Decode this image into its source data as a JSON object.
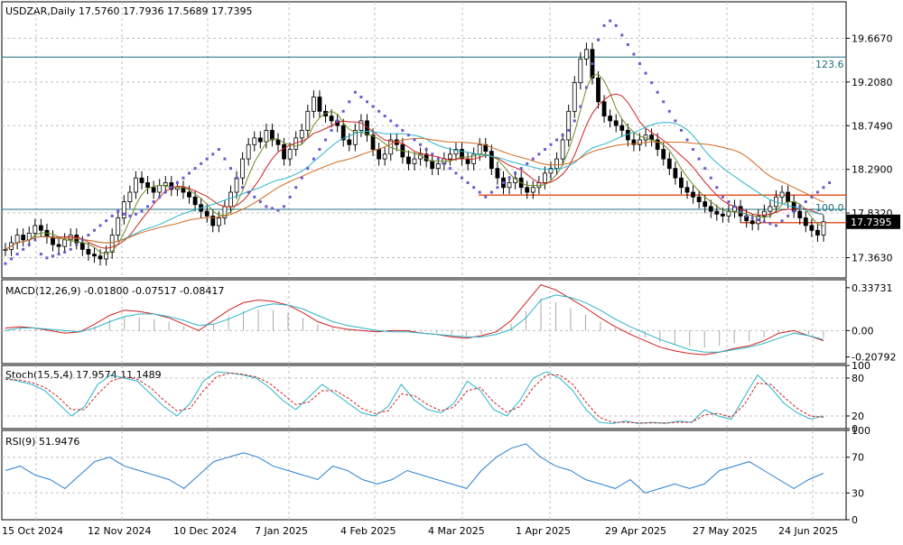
{
  "header": {
    "symbol_info": "USDZAR,Daily  17.5760 17.7936 17.5689 17.7395",
    "macd_info": "MACD(12,26,9) -0.01800 -0.07517 -0.08417",
    "stoch_info": "Stoch(15,5,4) 17.9574 11.1489",
    "rsi_info": "RSI(9) 51.9476"
  },
  "chart_data": [
    {
      "type": "candlestick",
      "title": "USDZAR,Daily",
      "ohlc_last": {
        "open": 17.576,
        "high": 17.7936,
        "low": 17.5689,
        "close": 17.7395
      },
      "ylim": [
        17.15,
        20.05
      ],
      "y_tick_labels": [
        "19.6670",
        "19.2080",
        "18.7490",
        "18.2900",
        "17.8320",
        "17.3630"
      ],
      "current_price_label": "17.7395",
      "x_tick_labels": [
        "15 Oct 2024",
        "12 Nov 2024",
        "10 Dec 2024",
        "7 Jan 2025",
        "4 Feb 2025",
        "4 Mar 2025",
        "1 Apr 2025",
        "29 Apr 2025",
        "27 May 2025",
        "24 Jun 2025"
      ],
      "fibonacci_labels": [
        "123.6",
        "100.0"
      ],
      "close_series": [
        17.45,
        17.52,
        17.6,
        17.55,
        17.62,
        17.7,
        17.65,
        17.58,
        17.5,
        17.48,
        17.55,
        17.6,
        17.52,
        17.45,
        17.4,
        17.38,
        17.35,
        17.42,
        17.6,
        17.78,
        17.95,
        18.05,
        18.2,
        18.15,
        18.1,
        18.05,
        18.12,
        18.15,
        18.08,
        18.1,
        18.05,
        18.0,
        17.92,
        17.85,
        17.8,
        17.7,
        17.78,
        17.9,
        18.05,
        18.2,
        18.4,
        18.55,
        18.62,
        18.58,
        18.7,
        18.6,
        18.55,
        18.4,
        18.5,
        18.62,
        18.7,
        18.9,
        19.05,
        18.9,
        18.85,
        18.8,
        18.75,
        18.6,
        18.55,
        18.7,
        18.8,
        18.65,
        18.5,
        18.4,
        18.45,
        18.6,
        18.55,
        18.42,
        18.35,
        18.4,
        18.45,
        18.38,
        18.3,
        18.35,
        18.4,
        18.45,
        18.5,
        18.4,
        18.35,
        18.45,
        18.55,
        18.48,
        18.3,
        18.2,
        18.1,
        18.15,
        18.2,
        18.1,
        18.05,
        18.1,
        18.15,
        18.25,
        18.3,
        18.4,
        18.6,
        18.9,
        19.2,
        19.45,
        19.55,
        19.25,
        19.0,
        18.85,
        18.8,
        18.75,
        18.7,
        18.6,
        18.55,
        18.6,
        18.65,
        18.6,
        18.5,
        18.4,
        18.3,
        18.2,
        18.1,
        18.05,
        18.0,
        17.95,
        17.9,
        17.85,
        17.82,
        17.8,
        17.85,
        17.9,
        17.8,
        17.75,
        17.72,
        17.8,
        17.85,
        17.9,
        18.0,
        18.05,
        17.95,
        17.85,
        17.78,
        17.7,
        17.65,
        17.6,
        17.74
      ],
      "parabolic_sar_series": [
        17.3,
        17.35,
        17.4,
        17.45,
        17.5,
        17.55,
        17.4,
        17.36,
        17.38,
        17.4,
        17.42,
        17.45,
        17.5,
        17.55,
        17.6,
        17.65,
        17.7,
        17.75,
        17.8,
        17.85,
        17.82,
        17.8,
        17.82,
        17.85,
        17.9,
        17.95,
        18.0,
        18.05,
        18.1,
        18.15,
        18.2,
        18.25,
        18.3,
        18.35,
        18.4,
        18.45,
        18.5,
        18.4,
        18.3,
        18.2,
        18.1,
        18.05,
        18.0,
        17.95,
        17.9,
        17.88,
        17.86,
        17.9,
        18.0,
        18.1,
        18.2,
        18.3,
        18.4,
        18.5,
        18.6,
        18.7,
        18.8,
        18.9,
        19.0,
        19.1,
        19.05,
        19.0,
        18.95,
        18.9,
        18.85,
        18.8,
        18.75,
        18.7,
        18.65,
        18.6,
        18.55,
        18.5,
        18.45,
        18.4,
        18.35,
        18.3,
        18.25,
        18.2,
        18.15,
        18.1,
        18.05,
        18.0,
        18.05,
        18.1,
        18.15,
        18.2,
        18.25,
        18.3,
        18.35,
        18.4,
        18.45,
        18.5,
        18.55,
        18.6,
        18.65,
        18.7,
        18.8,
        18.95,
        19.15,
        19.4,
        19.65,
        19.8,
        19.85,
        19.8,
        19.7,
        19.6,
        19.5,
        19.4,
        19.3,
        19.2,
        19.1,
        19.0,
        18.9,
        18.8,
        18.7,
        18.6,
        18.5,
        18.4,
        18.3,
        18.2,
        18.1,
        18.0,
        17.95,
        17.9,
        17.85,
        17.8,
        17.78,
        17.76,
        17.74,
        17.72,
        17.7,
        17.75,
        17.8,
        17.85,
        17.9,
        17.95,
        18.0,
        18.05,
        18.1,
        18.15
      ]
    },
    {
      "type": "line",
      "title": "MACD(12,26,9)",
      "values_text": "-0.01800 -0.07517 -0.08417",
      "ylim": [
        -0.26,
        0.4
      ],
      "y_tick_labels": [
        "0.33731",
        "0.00",
        "-0.20792"
      ],
      "series": [
        {
          "values": [
            0.02,
            0.03,
            0.02,
            0.0,
            -0.02,
            -0.01,
            0.05,
            0.12,
            0.16,
            0.15,
            0.13,
            0.1,
            0.05,
            0.0,
            0.08,
            0.16,
            0.22,
            0.24,
            0.23,
            0.2,
            0.14,
            0.07,
            0.03,
            0.01,
            0.0,
            -0.01,
            0.0,
            0.0,
            -0.02,
            -0.03,
            -0.05,
            -0.06,
            -0.04,
            -0.01,
            0.08,
            0.22,
            0.36,
            0.32,
            0.25,
            0.18,
            0.1,
            0.03,
            -0.03,
            -0.08,
            -0.13,
            -0.16,
            -0.18,
            -0.19,
            -0.17,
            -0.14,
            -0.12,
            -0.08,
            -0.02,
            0.0,
            -0.04,
            -0.08
          ]
        },
        {
          "values": [
            0.0,
            0.02,
            0.02,
            0.01,
            0.0,
            -0.01,
            0.02,
            0.07,
            0.11,
            0.13,
            0.13,
            0.11,
            0.08,
            0.04,
            0.05,
            0.09,
            0.14,
            0.19,
            0.21,
            0.2,
            0.17,
            0.12,
            0.07,
            0.04,
            0.02,
            0.0,
            -0.01,
            -0.01,
            -0.02,
            -0.03,
            -0.04,
            -0.05,
            -0.05,
            -0.03,
            0.01,
            0.1,
            0.24,
            0.28,
            0.26,
            0.22,
            0.16,
            0.09,
            0.03,
            -0.02,
            -0.07,
            -0.11,
            -0.15,
            -0.17,
            -0.17,
            -0.15,
            -0.13,
            -0.1,
            -0.06,
            -0.02,
            -0.04,
            -0.07
          ]
        }
      ]
    },
    {
      "type": "line",
      "title": "Stoch(15,5,4)",
      "values_text": "17.9574 11.1489",
      "ylim": [
        0,
        100
      ],
      "y_tick_labels": [
        "100",
        "80",
        "20",
        "0"
      ],
      "series": [
        {
          "values": [
            80,
            75,
            70,
            60,
            40,
            20,
            35,
            70,
            85,
            80,
            75,
            55,
            35,
            20,
            40,
            75,
            90,
            88,
            85,
            80,
            65,
            45,
            30,
            50,
            70,
            55,
            40,
            25,
            20,
            35,
            70,
            45,
            30,
            25,
            40,
            75,
            60,
            30,
            20,
            45,
            80,
            90,
            80,
            60,
            30,
            10,
            8,
            12,
            8,
            10,
            8,
            12,
            10,
            30,
            20,
            15,
            50,
            85,
            65,
            40,
            25,
            15,
            20
          ]
        },
        {
          "values": [
            78,
            77,
            73,
            65,
            50,
            30,
            30,
            55,
            75,
            82,
            78,
            65,
            45,
            28,
            32,
            60,
            82,
            88,
            86,
            82,
            72,
            55,
            38,
            42,
            60,
            60,
            48,
            32,
            24,
            28,
            55,
            52,
            38,
            28,
            34,
            60,
            65,
            42,
            26,
            35,
            65,
            85,
            85,
            70,
            42,
            18,
            10,
            10,
            9,
            9,
            9,
            10,
            10,
            22,
            24,
            18,
            38,
            72,
            70,
            50,
            32,
            20,
            18
          ]
        }
      ]
    },
    {
      "type": "line",
      "title": "RSI(9)",
      "values_text": "51.9476",
      "ylim": [
        0,
        100
      ],
      "y_tick_labels": [
        "100",
        "70",
        "30",
        "0"
      ],
      "series": [
        {
          "values": [
            55,
            60,
            50,
            45,
            35,
            50,
            65,
            70,
            60,
            55,
            50,
            45,
            35,
            50,
            65,
            70,
            75,
            70,
            60,
            55,
            50,
            45,
            60,
            55,
            45,
            40,
            45,
            55,
            50,
            45,
            40,
            35,
            55,
            70,
            80,
            85,
            70,
            60,
            55,
            45,
            40,
            35,
            45,
            30,
            35,
            40,
            35,
            40,
            55,
            60,
            65,
            55,
            45,
            35,
            45,
            52
          ]
        }
      ]
    }
  ],
  "colors": {
    "grid": "#c0c0c0",
    "price_bars": "#000000",
    "sar": "#6a5acd",
    "ma_red": "#d12020",
    "ma_cyan": "#2bb4cc",
    "ma_olive": "#6b8e23",
    "ma_orange": "#d2691e",
    "fib_line": "#1f6f7f",
    "support_orange": "#e3582a",
    "macd_main": "#d12020",
    "macd_signal": "#2bb4cc",
    "macd_hist": "#a9a9a9",
    "stoch_main": "#2bb4cc",
    "stoch_signal": "#d12020",
    "rsi": "#2a7fcf"
  }
}
